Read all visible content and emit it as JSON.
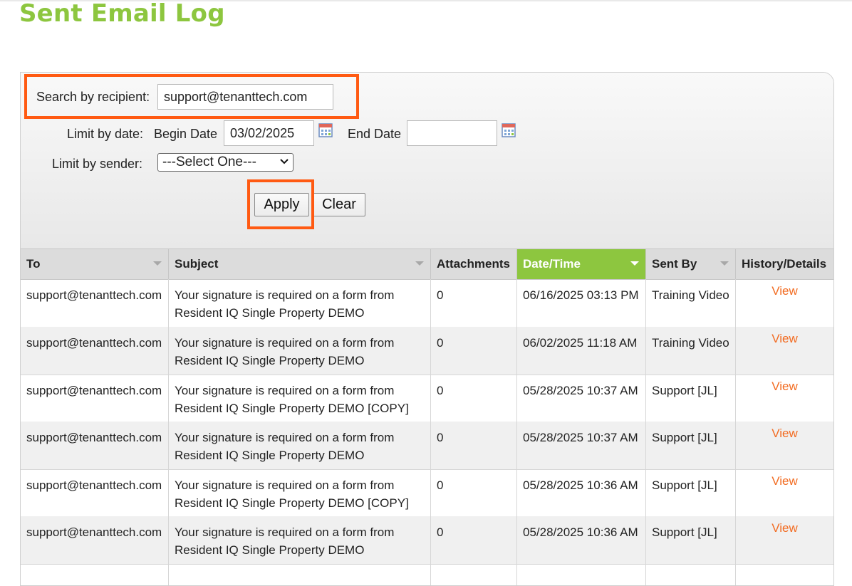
{
  "page": {
    "title": "Sent Email Log"
  },
  "filters": {
    "recipient_label": "Search by recipient:",
    "recipient_value": "support@tenanttech.com",
    "date_label": "Limit by date:",
    "begin_label": "Begin Date",
    "begin_value": "03/02/2025",
    "end_label": "End Date",
    "end_value": "",
    "sender_label": "Limit by sender:",
    "sender_selected": "---Select One---",
    "apply_label": "Apply",
    "clear_label": "Clear"
  },
  "table": {
    "columns": [
      "To",
      "Subject",
      "Attachments",
      "Date/Time",
      "Sent By",
      "History/Details"
    ],
    "sorted_column": "Date/Time",
    "link_label": "View",
    "rows": [
      {
        "to": "support@tenanttech.com",
        "subject": "Your signature is required on a form from Resident IQ Single Property DEMO",
        "attachments": "0",
        "datetime": "06/16/2025 03:13 PM",
        "sent_by": "Training Video"
      },
      {
        "to": "support@tenanttech.com",
        "subject": "Your signature is required on a form from Resident IQ Single Property DEMO",
        "attachments": "0",
        "datetime": "06/02/2025 11:18 AM",
        "sent_by": "Training Video"
      },
      {
        "to": "support@tenanttech.com",
        "subject": "Your signature is required on a form from Resident IQ Single Property DEMO [COPY]",
        "attachments": "0",
        "datetime": "05/28/2025 10:37 AM",
        "sent_by": "Support [JL]"
      },
      {
        "to": "support@tenanttech.com",
        "subject": "Your signature is required on a form from Resident IQ Single Property DEMO",
        "attachments": "0",
        "datetime": "05/28/2025 10:37 AM",
        "sent_by": "Support [JL]"
      },
      {
        "to": "support@tenanttech.com",
        "subject": "Your signature is required on a form from Resident IQ Single Property DEMO [COPY]",
        "attachments": "0",
        "datetime": "05/28/2025 10:36 AM",
        "sent_by": "Support [JL]"
      },
      {
        "to": "support@tenanttech.com",
        "subject": "Your signature is required on a form from Resident IQ Single Property DEMO",
        "attachments": "0",
        "datetime": "05/28/2025 10:36 AM",
        "sent_by": "Support [JL]"
      }
    ]
  },
  "colors": {
    "accent": "#8dc63f",
    "highlight": "#ff5a12",
    "link": "#f26b21"
  },
  "icons": {
    "calendar": "calendar-icon",
    "dropdown": "chevron-down-icon",
    "sort": "sort-arrow-icon"
  }
}
